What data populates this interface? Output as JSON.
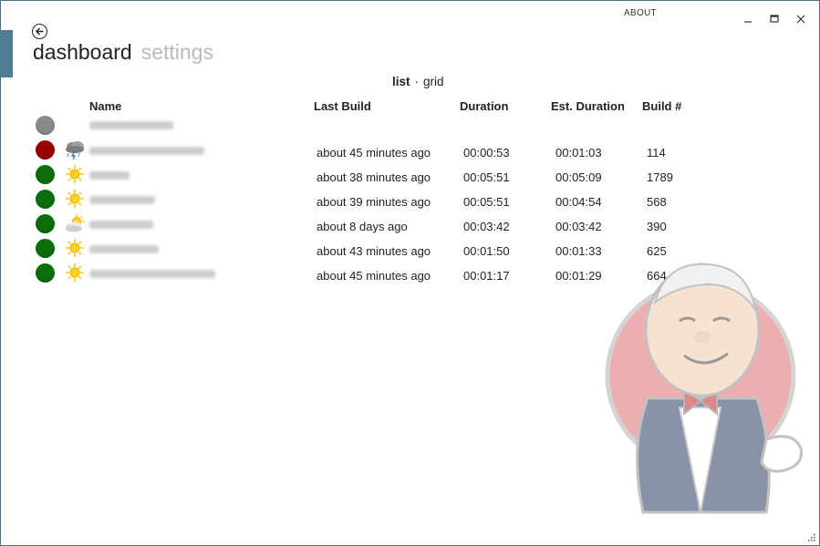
{
  "window": {
    "about_label": "ABOUT",
    "minimize_glyph": "—",
    "maximize_glyph": "☐",
    "close_glyph": "✕"
  },
  "nav": {
    "tabs": [
      {
        "label": "dashboard",
        "active": true
      },
      {
        "label": "settings",
        "active": false
      }
    ]
  },
  "view_toggle": {
    "list_label": "list",
    "separator": "·",
    "grid_label": "grid",
    "selected": "list"
  },
  "table": {
    "columns": {
      "name": "Name",
      "last_build": "Last Build",
      "duration": "Duration",
      "est_duration": "Est. Duration",
      "build_number": "Build #"
    },
    "rows": [
      {
        "status": "disabled",
        "status_color": "#8a8a8a",
        "weather": "none",
        "last_build": "",
        "duration": "",
        "est_duration": "",
        "build_number": ""
      },
      {
        "status": "failed",
        "status_color": "#9b0000",
        "weather": "thunderstorm-icon",
        "last_build": "about 45 minutes ago",
        "duration": "00:00:53",
        "est_duration": "00:01:03",
        "build_number": "114"
      },
      {
        "status": "success",
        "status_color": "#0b6e0b",
        "weather": "sun-icon",
        "last_build": "about 38 minutes ago",
        "duration": "00:05:51",
        "est_duration": "00:05:09",
        "build_number": "1789"
      },
      {
        "status": "success",
        "status_color": "#0b6e0b",
        "weather": "sun-icon",
        "last_build": "about 39 minutes ago",
        "duration": "00:05:51",
        "est_duration": "00:04:54",
        "build_number": "568"
      },
      {
        "status": "success",
        "status_color": "#0b6e0b",
        "weather": "partly-cloudy-icon",
        "last_build": "about 8 days ago",
        "duration": "00:03:42",
        "est_duration": "00:03:42",
        "build_number": "390"
      },
      {
        "status": "success",
        "status_color": "#0b6e0b",
        "weather": "sun-icon",
        "last_build": "about 43 minutes ago",
        "duration": "00:01:50",
        "est_duration": "00:01:33",
        "build_number": "625"
      },
      {
        "status": "success",
        "status_color": "#0b6e0b",
        "weather": "sun-icon",
        "last_build": "about 45 minutes ago",
        "duration": "00:01:17",
        "est_duration": "00:01:29",
        "build_number": "664"
      }
    ]
  },
  "colors": {
    "accent": "#4f7d92",
    "failed": "#9b0000",
    "success": "#0b6e0b",
    "disabled": "#8a8a8a",
    "inactive_tab": "#b9b9b9"
  },
  "icons": {
    "back": "back-arrow-icon",
    "mascot": "jenkins-butler-icon",
    "resize": "resize-grip-icon"
  }
}
